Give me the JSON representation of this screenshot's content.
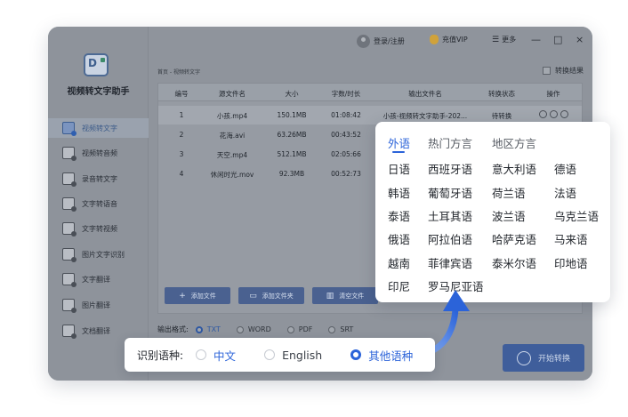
{
  "window": {
    "app_name": "视频转文字助手",
    "logo_text": "D",
    "topbar": {
      "login": "登录/注册",
      "vip": "充值VIP",
      "more": "更多",
      "minimize": "—",
      "maximize": "□",
      "close": "×"
    },
    "breadcrumb": "首页 - 视频转文字",
    "toggle_result": "转换结果"
  },
  "sidebar": {
    "items": [
      {
        "label": "视频转文字",
        "active": true
      },
      {
        "label": "视频转音频"
      },
      {
        "label": "录音转文字"
      },
      {
        "label": "文字转语音"
      },
      {
        "label": "文字转视频"
      },
      {
        "label": "图片文字识别"
      },
      {
        "label": "文字翻译"
      },
      {
        "label": "图片翻译"
      },
      {
        "label": "文档翻译"
      }
    ]
  },
  "table": {
    "columns": [
      "编号",
      "源文件名",
      "大小",
      "字数/时长",
      "输出文件名",
      "转换状态",
      "操作"
    ],
    "rows": [
      {
        "no": "1",
        "name": "小孩.mp4",
        "size": "150.1MB",
        "duration": "01:08:42",
        "output": "小孩-视频转文字助手-202...",
        "status": "待转换"
      },
      {
        "no": "2",
        "name": "花海.avi",
        "size": "63.26MB",
        "duration": "00:43:52",
        "output": "",
        "status": ""
      },
      {
        "no": "3",
        "name": "天空.mp4",
        "size": "512.1MB",
        "duration": "02:05:66",
        "output": "",
        "status": ""
      },
      {
        "no": "4",
        "name": "休闲时光.mov",
        "size": "92.3MB",
        "duration": "00:52:73",
        "output": "",
        "status": ""
      }
    ]
  },
  "buttons": {
    "add_file": "添加文件",
    "add_folder": "添加文件夹",
    "clear": "清空文件",
    "start": "开始转换"
  },
  "output_format": {
    "label": "输出格式:",
    "options": [
      "TXT",
      "WORD",
      "PDF",
      "SRT"
    ],
    "selected": "TXT"
  },
  "language_panel": {
    "tabs": [
      "外语",
      "热门方言",
      "地区方言"
    ],
    "active_tab": "外语",
    "languages": [
      [
        "日语",
        "西班牙语",
        "意大利语",
        "德语"
      ],
      [
        "韩语",
        "葡萄牙语",
        "荷兰语",
        "法语"
      ],
      [
        "泰语",
        "土耳其语",
        "波兰语",
        "乌克兰语"
      ],
      [
        "俄语",
        "阿拉伯语",
        "哈萨克语",
        "马来语"
      ],
      [
        "越南",
        "菲律宾语",
        "泰米尔语",
        "印地语"
      ],
      [
        "印尼",
        "罗马尼亚语"
      ]
    ]
  },
  "recognition": {
    "label": "识别语种:",
    "options": [
      "中文",
      "English",
      "其他语种"
    ],
    "selected": "其他语种"
  },
  "colors": {
    "accent": "#2b63d9",
    "overlay": "#8f949c"
  }
}
